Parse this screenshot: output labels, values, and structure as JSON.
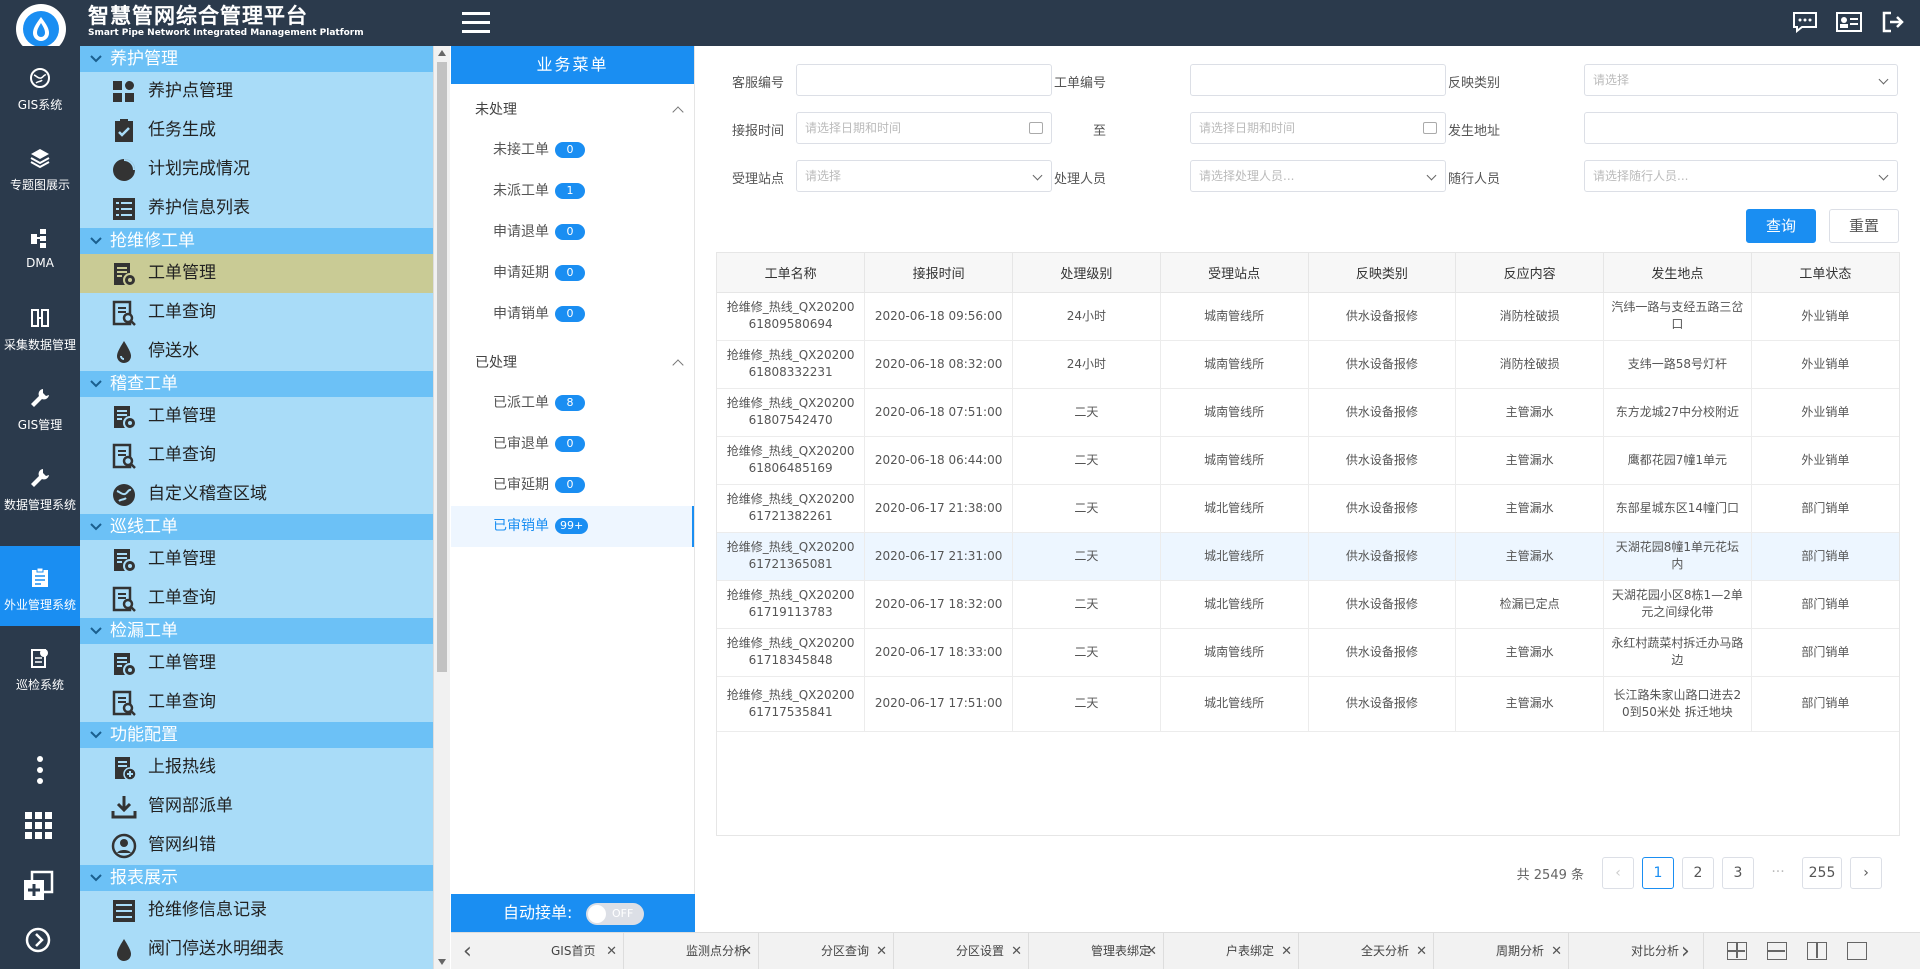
{
  "app": {
    "title": "智慧管网综合管理平台",
    "subtitle": "Smart Pipe Network Integrated Management Platform"
  },
  "colors": {
    "topbar": "#2b3a4c",
    "accent": "#1a8ef2",
    "menu_bg": "#a9dcf8",
    "menu_section": "#6cc1f6",
    "menu_selected": "#c9cb95"
  },
  "leftnav": [
    {
      "label": "GIS系统",
      "icon": "globe-icon"
    },
    {
      "label": "专题图展示",
      "icon": "layers-icon"
    },
    {
      "label": "DMA",
      "icon": "dma-icon"
    },
    {
      "label": "采集数据管理",
      "icon": "data-collect-icon"
    },
    {
      "label": "GIS管理",
      "icon": "wrench-icon"
    },
    {
      "label": "数据管理系统",
      "icon": "wrench-icon"
    },
    {
      "label": "外业管理系统",
      "icon": "clipboard-icon"
    },
    {
      "label": "巡检系统",
      "icon": "inspection-icon"
    }
  ],
  "menu": {
    "s1": "养护管理",
    "s1i1": "养护点管理",
    "s1i2": "任务生成",
    "s1i3": "计划完成情况",
    "s1i4": "养护信息列表",
    "s2": "抢维修工单",
    "s2i1": "工单管理",
    "s2i2": "工单查询",
    "s2i3": "停送水",
    "s3": "稽查工单",
    "s3i1": "工单管理",
    "s3i2": "工单查询",
    "s3i3": "自定义稽查区域",
    "s4": "巡线工单",
    "s4i1": "工单管理",
    "s4i2": "工单查询",
    "s5": "检漏工单",
    "s5i1": "工单管理",
    "s5i2": "工单查询",
    "s6": "功能配置",
    "s6i1": "上报热线",
    "s6i2": "管网部派单",
    "s6i3": "管网纠错",
    "s7": "报表展示",
    "s7i1": "抢维修信息记录",
    "s7i2": "阀门停送水明细表"
  },
  "biz": {
    "header": "业务菜单",
    "g1": "未处理",
    "g1items": [
      {
        "label": "未接工单",
        "count": "0"
      },
      {
        "label": "未派工单",
        "count": "1"
      },
      {
        "label": "申请退单",
        "count": "0"
      },
      {
        "label": "申请延期",
        "count": "0"
      },
      {
        "label": "申请销单",
        "count": "0"
      }
    ],
    "g2": "已处理",
    "g2items": [
      {
        "label": "已派工单",
        "count": "8"
      },
      {
        "label": "已审退单",
        "count": "0"
      },
      {
        "label": "已审延期",
        "count": "0"
      },
      {
        "label": "已审销单",
        "count": "99+"
      }
    ],
    "auto_label": "自动接单:",
    "toggle": "OFF"
  },
  "filters": {
    "l_kf": "客服编号",
    "l_gd": "工单编号",
    "l_fy": "反映类别",
    "p_select": "请选择",
    "l_jb": "接报时间",
    "p_date": "请选择日期和时间",
    "l_to": "至",
    "l_addr": "发生地址",
    "l_site": "受理站点",
    "l_handler": "处理人员",
    "p_handler": "请选择处理人员...",
    "l_follow": "随行人员",
    "p_follow": "请选择随行人员...",
    "query": "查询",
    "reset": "重置"
  },
  "table": {
    "headers": [
      "工单名称",
      "接报时间",
      "处理级别",
      "受理站点",
      "反映类别",
      "反应内容",
      "发生地点",
      "工单状态"
    ],
    "rows": [
      [
        "抢维修_热线_QX2020061809580694",
        "2020-06-18 09:56:00",
        "24小时",
        "城南管线所",
        "供水设备报修",
        "消防栓破损",
        "汽纬一路与支经五路三岔口",
        "外业销单"
      ],
      [
        "抢维修_热线_QX2020061808332231",
        "2020-06-18 08:32:00",
        "24小时",
        "城南管线所",
        "供水设备报修",
        "消防栓破损",
        "支纬一路58号灯杆",
        "外业销单"
      ],
      [
        "抢维修_热线_QX2020061807542470",
        "2020-06-18 07:51:00",
        "二天",
        "城南管线所",
        "供水设备报修",
        "主管漏水",
        "东方龙城27中分校附近",
        "外业销单"
      ],
      [
        "抢维修_热线_QX2020061806485169",
        "2020-06-18 06:44:00",
        "二天",
        "城南管线所",
        "供水设备报修",
        "主管漏水",
        "鹰都花园7幢1单元",
        "外业销单"
      ],
      [
        "抢维修_热线_QX2020061721382261",
        "2020-06-17 21:38:00",
        "二天",
        "城北管线所",
        "供水设备报修",
        "主管漏水",
        "东部星城东区14幢门口",
        "部门销单"
      ],
      [
        "抢维修_热线_QX2020061721365081",
        "2020-06-17 21:31:00",
        "二天",
        "城北管线所",
        "供水设备报修",
        "主管漏水",
        "天湖花园8幢1单元花坛内",
        "部门销单"
      ],
      [
        "抢维修_热线_QX2020061719113783",
        "2020-06-17 18:32:00",
        "二天",
        "城北管线所",
        "供水设备报修",
        "检漏已定点",
        "天湖花园小区8栋1—2单元之间绿化带",
        "部门销单"
      ],
      [
        "抢维修_热线_QX2020061718345848",
        "2020-06-17 18:33:00",
        "二天",
        "城南管线所",
        "供水设备报修",
        "主管漏水",
        "永红村蔬菜村拆迁办马路边",
        "部门销单"
      ],
      [
        "抢维修_热线_QX2020061717535841",
        "2020-06-17 17:51:00",
        "二天",
        "城北管线所",
        "供水设备报修",
        "主管漏水",
        "长江路朱家山路口进去20到50米处 拆迁地块",
        "部门销单"
      ]
    ]
  },
  "pager": {
    "total": "共 2549 条",
    "p1": "1",
    "p2": "2",
    "p3": "3",
    "more": "···",
    "last": "255"
  },
  "tabs": [
    "GIS首页",
    "监测点分析",
    "分区查询",
    "分区设置",
    "管理表绑定",
    "户表绑定",
    "全天分析",
    "周期分析",
    "对比分析"
  ]
}
